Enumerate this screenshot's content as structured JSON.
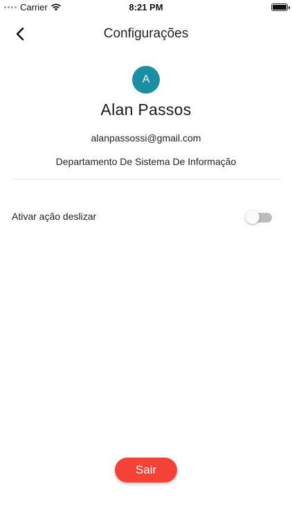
{
  "status_bar": {
    "carrier": "Carrier",
    "time": "8:21 PM",
    "icons": [
      "signal-dots-icon",
      "wifi-icon",
      "battery-icon"
    ]
  },
  "nav": {
    "back_icon": "chevron-left-icon",
    "title": "Configurações"
  },
  "profile": {
    "avatar_initial": "A",
    "avatar_color": "#1a8fa3",
    "name": "Alan Passos",
    "email": "alanpassossi@gmail.com",
    "department": "Departamento De Sistema De Informação"
  },
  "settings": {
    "swipe_action_label": "Ativar ação deslizar",
    "swipe_action_enabled": false
  },
  "actions": {
    "logout_label": "Sair",
    "logout_color": "#f44336"
  }
}
